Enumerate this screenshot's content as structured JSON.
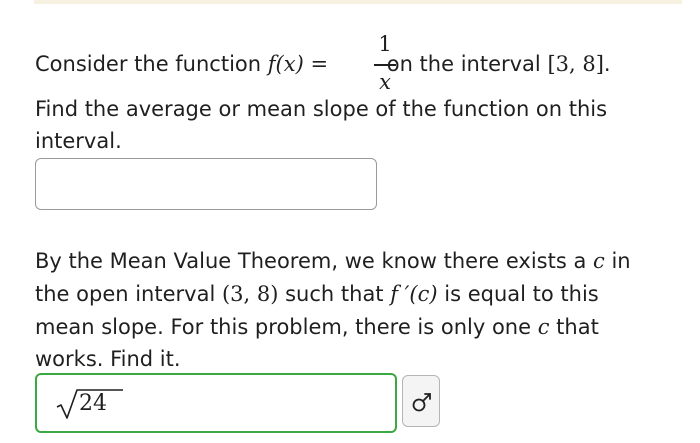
{
  "question1": {
    "prefix": "Consider the function ",
    "func": "f(x) =",
    "numerator": "1",
    "denominator": "x",
    "mid": " on the interval ",
    "interval": "[3, 8]",
    "suffix": ".",
    "line2": "Find the average or mean slope of the function on this",
    "line3": "interval."
  },
  "answer1": {
    "value": ""
  },
  "question2": {
    "l1_text": "By the Mean Value Theorem, we know there exists a ",
    "l1_var": "c",
    "l1_end": " in",
    "l2_text": "the open interval ",
    "l2_interval": "(3, 8)",
    "l2_mid": " such that ",
    "l2_deriv": "f ′(c)",
    "l2_end": " is equal to this",
    "l3_text": "mean slope. For this problem, there is only one ",
    "l3_var": "c",
    "l3_end": " that",
    "l4_text": "works. Find it."
  },
  "answer2": {
    "radicand": "24",
    "status": "correct"
  },
  "icons": {
    "check": "check-icon",
    "preview": "preview-icon"
  },
  "colors": {
    "correct": "#3aa843",
    "correct_check": "#2e9a3a"
  }
}
